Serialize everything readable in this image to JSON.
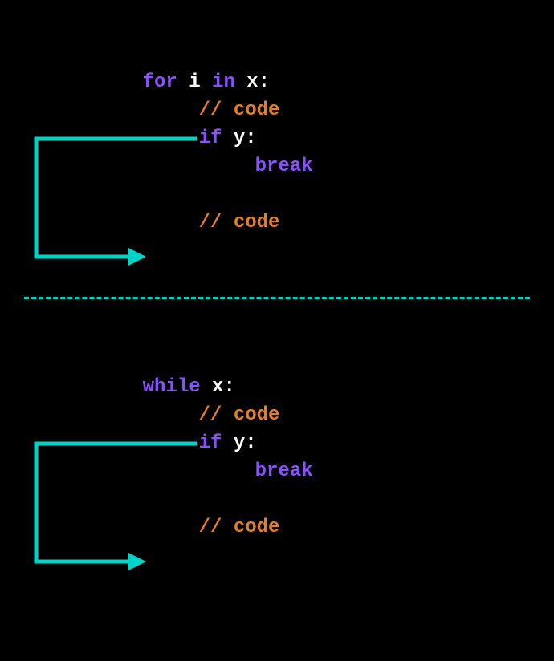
{
  "colors": {
    "keyword": "#8a4fff",
    "variable": "#ffffff",
    "comment": "#e67e22",
    "arrow": "#00d4c8",
    "background": "#000000"
  },
  "block1": {
    "line1": {
      "for": "for",
      "i": "i",
      "in": "in",
      "x": "x",
      "colon": ":"
    },
    "line2": {
      "comment": "// code"
    },
    "line3": {
      "if": "if",
      "cond": "y",
      "colon": ":"
    },
    "line4": {
      "break": "break"
    },
    "line5": {
      "comment": "// code"
    }
  },
  "block2": {
    "line1": {
      "while": "while",
      "cond": "x",
      "colon": ":"
    },
    "line2": {
      "comment": "// code"
    },
    "line3": {
      "if": "if",
      "cond": "y",
      "colon": ":"
    },
    "line4": {
      "break": "break"
    },
    "line5": {
      "comment": "// code"
    }
  },
  "semantics": {
    "description": "Diagram showing that 'break' exits a for-loop and a while-loop, jumping to the code after the loop body.",
    "arrow_meaning": "break statement exits loop and continues after it"
  }
}
